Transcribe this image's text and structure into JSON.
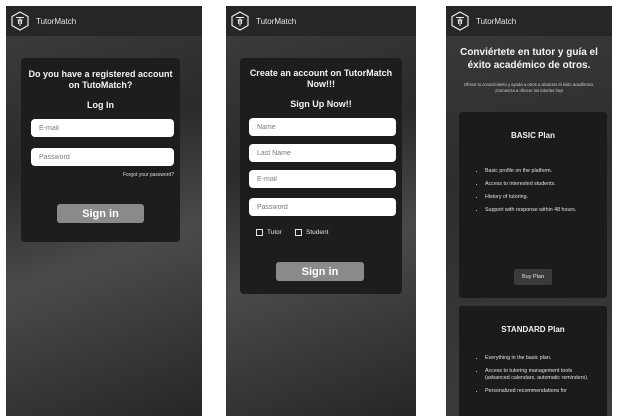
{
  "brand": "TutorMatch",
  "login": {
    "title": "Do you have a registered account on TutoMatch?",
    "subtitle": "Log In",
    "email_placeholder": "E-mail",
    "password_placeholder": "Password",
    "forgot_link": "Forgot your password?",
    "signin_button": "Sign in"
  },
  "signup": {
    "title": "Create an account on TutorMatch Now!!!",
    "subtitle": "Sign Up Now!!",
    "name_placeholder": "Name",
    "lastname_placeholder": "Last Name",
    "email_placeholder": "E-mail",
    "password_placeholder": "Password",
    "role_tutor": "Tutor",
    "role_student": "Student",
    "signin_button": "Sign in"
  },
  "tutor": {
    "headline": "Conviértete en tutor y guía el éxito académico de otros.",
    "description": "Ofrece tu conocimiento y ayuda a otros a alcanzar el éxito académico. ¡Comienza a ofrecer tus tutorías hoy!",
    "plans": [
      {
        "name": "BASIC Plan",
        "features": [
          "Basic profile on the platform.",
          "Access to interested students.",
          "History of tutoring.",
          "Support with response within 48 hours."
        ],
        "button": "Buy Plan"
      },
      {
        "name": "STANDARD Plan",
        "features": [
          "Everything in the basic plan.",
          "Access to tutoring management tools (advanced calendars, automatic reminders).",
          "Personalized recommendations for"
        ]
      }
    ]
  }
}
